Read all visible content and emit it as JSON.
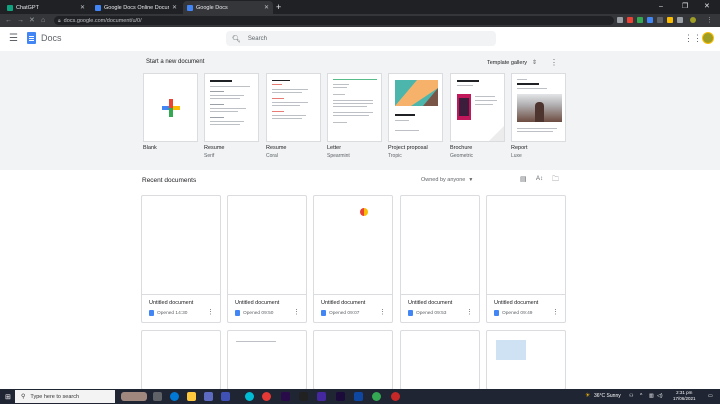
{
  "browser": {
    "tabs": [
      {
        "title": "ChatGPT",
        "favicon_color": "#10a37f",
        "active": false
      },
      {
        "title": "Google Docs Online Document",
        "favicon_color": "#4285f4",
        "active": false
      },
      {
        "title": "Google Docs",
        "favicon_color": "#4285f4",
        "active": true
      }
    ],
    "url": "docs.google.com/document/u/0/"
  },
  "header": {
    "app_name": "Docs",
    "search_placeholder": "Search"
  },
  "templates": {
    "start_label": "Start a new document",
    "gallery_label": "Template gallery",
    "items": [
      {
        "name": "Blank",
        "sub": ""
      },
      {
        "name": "Resume",
        "sub": "Serif"
      },
      {
        "name": "Resume",
        "sub": "Coral"
      },
      {
        "name": "Letter",
        "sub": "Spearmint"
      },
      {
        "name": "Project proposal",
        "sub": "Tropic"
      },
      {
        "name": "Brochure",
        "sub": "Geometric"
      },
      {
        "name": "Report",
        "sub": "Luxe"
      }
    ]
  },
  "recent": {
    "title": "Recent documents",
    "owned_filter": "Owned by anyone",
    "docs": [
      {
        "name": "Untitled document",
        "meta": "Opened 14:30"
      },
      {
        "name": "Untitled document",
        "meta": "Opened 09:50"
      },
      {
        "name": "Untitled document",
        "meta": "Opened 09:07"
      },
      {
        "name": "Untitled document",
        "meta": "Opened 09:53"
      },
      {
        "name": "Untitled document",
        "meta": "Opened 09:49"
      }
    ]
  },
  "taskbar": {
    "search_placeholder": "Type here to search",
    "weather": "36°C  Sunny",
    "time": "2:31 pm",
    "date": "17/06/2021"
  }
}
